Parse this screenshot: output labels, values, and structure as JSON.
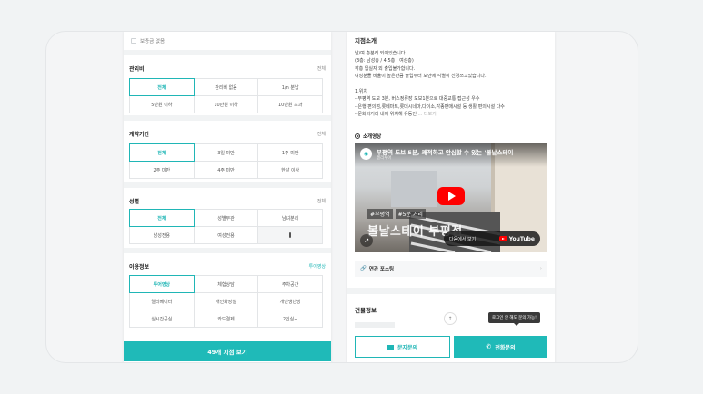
{
  "filter": {
    "top_option": "보증금 없음",
    "sections": [
      {
        "title": "관리비",
        "all": "전체",
        "options": [
          "전체",
          "관리비 없음",
          "1/n 분납",
          "5만원 이하",
          "10만원 이하",
          "10만원 초과"
        ],
        "selected": 0
      },
      {
        "title": "계약기간",
        "all": "전체",
        "options": [
          "전체",
          "3일 미만",
          "1주 미만",
          "2주 미만",
          "4주 미만",
          "한달 이상"
        ],
        "selected": 0
      },
      {
        "title": "성별",
        "all": "전체",
        "options": [
          "전체",
          "성별무관",
          "남녀분리",
          "남성전용",
          "여성전용",
          ""
        ],
        "selected": 0
      },
      {
        "title": "이용정보",
        "all": "투어영상",
        "options": [
          "투어영상",
          "체험상담",
          "주차공간",
          "엘리베이터",
          "개인화장실",
          "개인냉난방",
          "실시간공실",
          "카드결제",
          "2인실+"
        ],
        "selected": 0
      }
    ],
    "cta": "49개 지점 보기"
  },
  "detail": {
    "title": "지점소개",
    "description": [
      "남/여 층분리 되어있습니다.",
      "(3층: 남성층 / 4,5층 : 여성층)",
      "각층 입실자 외 출입불가합니다.",
      "여성분들 비율이 높은만큼 출입부터 보안에 각별히 신경쓰고있습니다.",
      "",
      "1.위치",
      "- 부평역 도보 3분, 버스정류장 도보1분으로 대중교통 접근성 우수",
      "- 은행,편의점,롯데마트,롯데시네마,다이소,각종판매시설 등 생활 편의시설 다수",
      "- 문화의거리 내에 위치해 유동인"
    ],
    "more": "... 더보기",
    "video_label": "소개영상",
    "video": {
      "title": "부평역 도보 5분, 쾌적하고 안심할 수 있는 '볼날스테이",
      "channel": "멜리투어",
      "tags": [
        "#부평역",
        "#5분 거리"
      ],
      "overlay": "볼날스테이 부평점",
      "watch_on": "다음에서 보기",
      "youtube": "YouTube"
    },
    "related": "연관 포스팅",
    "building_title": "건물정보",
    "tooltip": "로그인 안 해도 문의 가능!",
    "btn_message": "문자문의",
    "btn_call": "전화문의"
  }
}
